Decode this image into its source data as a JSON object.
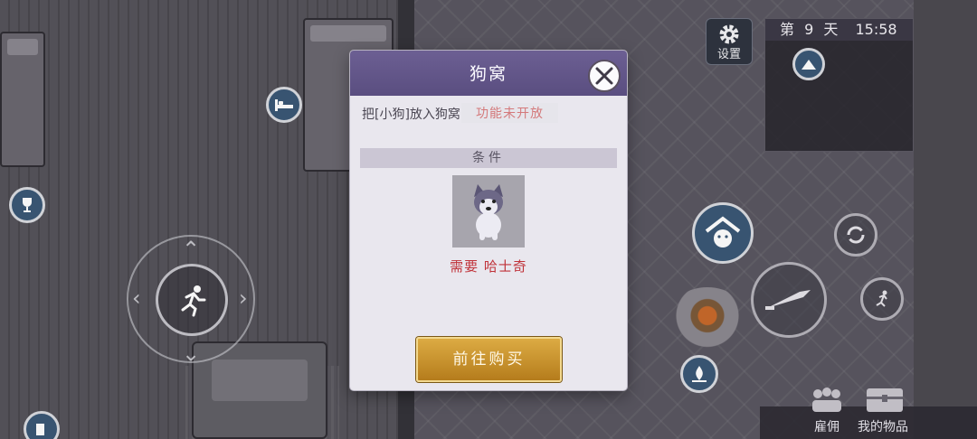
{
  "hud": {
    "settings_label": "设置",
    "day_prefix": "第",
    "day_number": "9",
    "day_suffix": "天",
    "clock": "15:58",
    "bottom_left_label": "雇佣",
    "bottom_right_label": "我的物品"
  },
  "dialog": {
    "title": "狗窝",
    "put_in_text": "把[小狗]放入狗窝",
    "feature_notice": "功能未开放",
    "condition_header": "条件",
    "requirement_text": "需要 哈士奇",
    "buy_button_label": "前往购买"
  },
  "colors": {
    "dialog_header": "#5f5386",
    "requirement_red": "#c0333a",
    "buy_button_gold": "#c8922e",
    "hud_blue": "#3b5876"
  }
}
